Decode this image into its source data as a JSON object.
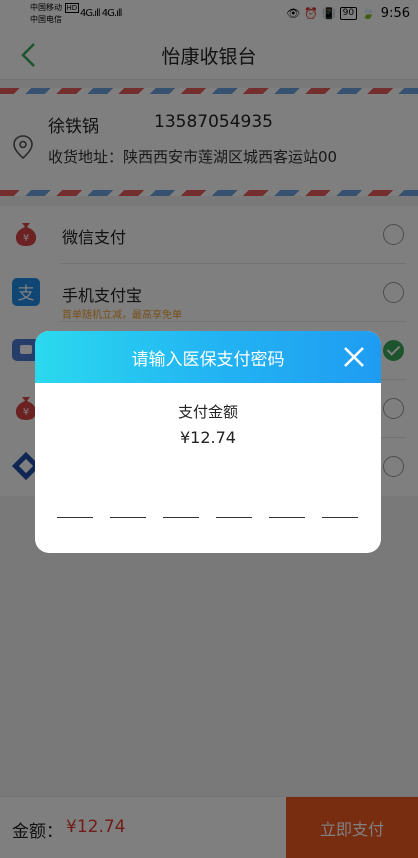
{
  "status_bar": {
    "carrier1": "中国移动",
    "carrier1_badge": "HD",
    "carrier2": "中国电信",
    "signal": "4G.ıll 4G.ıll",
    "battery": "90",
    "time": "9:56"
  },
  "header": {
    "title": "怡康收银台"
  },
  "address": {
    "name": "徐铁锅",
    "phone": "13587054935",
    "line": "收货地址：陕西西安市莲湖区城西客运站00"
  },
  "methods": [
    {
      "label": "微信支付",
      "sub": "",
      "selected": false
    },
    {
      "label": "手机支付宝",
      "sub": "首单随机立减，最高享免单",
      "selected": false
    },
    {
      "label": "",
      "sub": "",
      "selected": true
    },
    {
      "label": "",
      "sub": "",
      "selected": false
    },
    {
      "label": "",
      "sub": "",
      "selected": false
    }
  ],
  "footer": {
    "amount_label": "金额：",
    "amount": "¥12.74",
    "pay_label": "立即支付"
  },
  "dialog": {
    "title": "请输入医保支付密码",
    "amount_label": "支付金额",
    "amount": "¥12.74",
    "pin_length": 6
  },
  "colors": {
    "accent_green": "#3aa85a",
    "pay_orange": "#f05a22",
    "price_red": "#e23b2e",
    "dialog_header": "#23b5f3"
  }
}
